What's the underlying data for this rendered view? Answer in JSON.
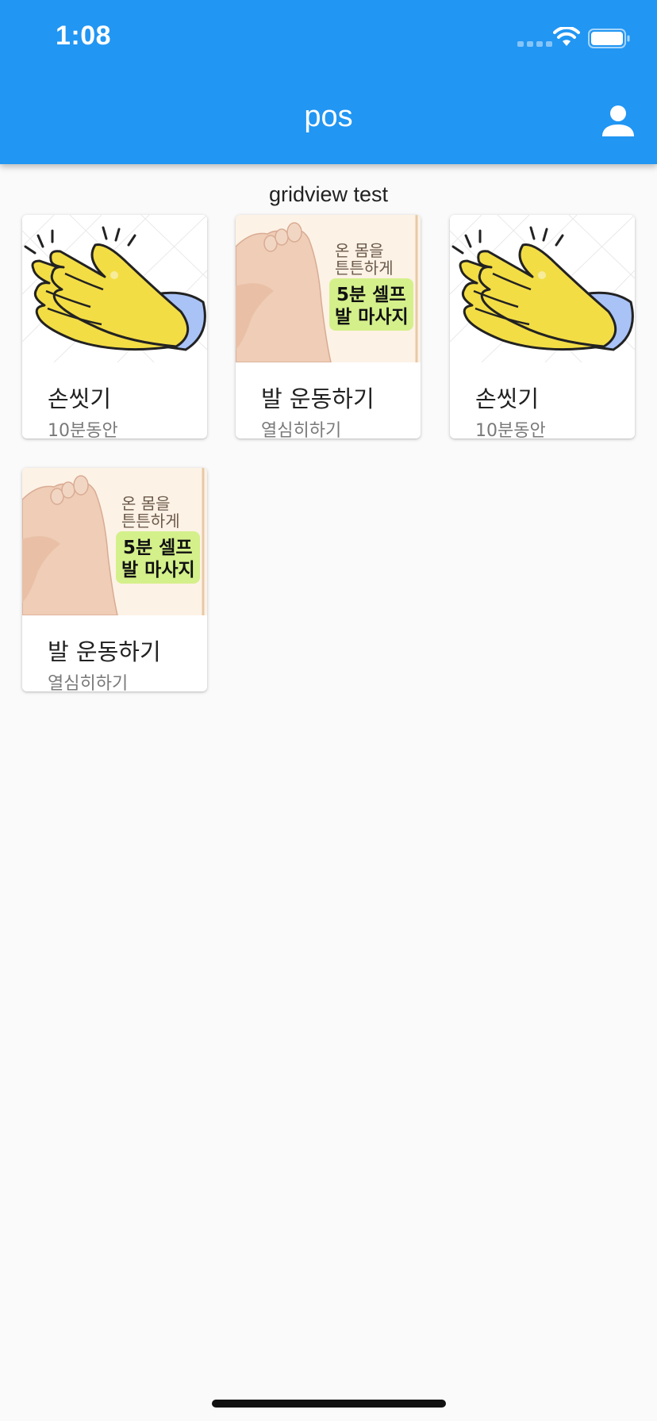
{
  "status_bar": {
    "time": "1:08"
  },
  "app_bar": {
    "title": "pos",
    "color": "#2196f3",
    "action_icon": "person-icon"
  },
  "section": {
    "title": "gridview test"
  },
  "cards": [
    {
      "title": "손씻기",
      "subtitle": "10분동안",
      "image": "clapping-hands-illustration"
    },
    {
      "title": "발 운동하기",
      "subtitle": "열심히하기",
      "image": "foot-massage-illustration",
      "image_text": [
        "온 몸을",
        "튼튼하게",
        "5분 셀프",
        "발 마사지"
      ]
    },
    {
      "title": "손씻기",
      "subtitle": "10분동안",
      "image": "clapping-hands-illustration"
    },
    {
      "title": "발 운동하기",
      "subtitle": "열심히하기",
      "image": "foot-massage-illustration",
      "image_text": [
        "온 몸을",
        "튼튼하게",
        "5분 셀프",
        "발 마사지"
      ]
    }
  ]
}
